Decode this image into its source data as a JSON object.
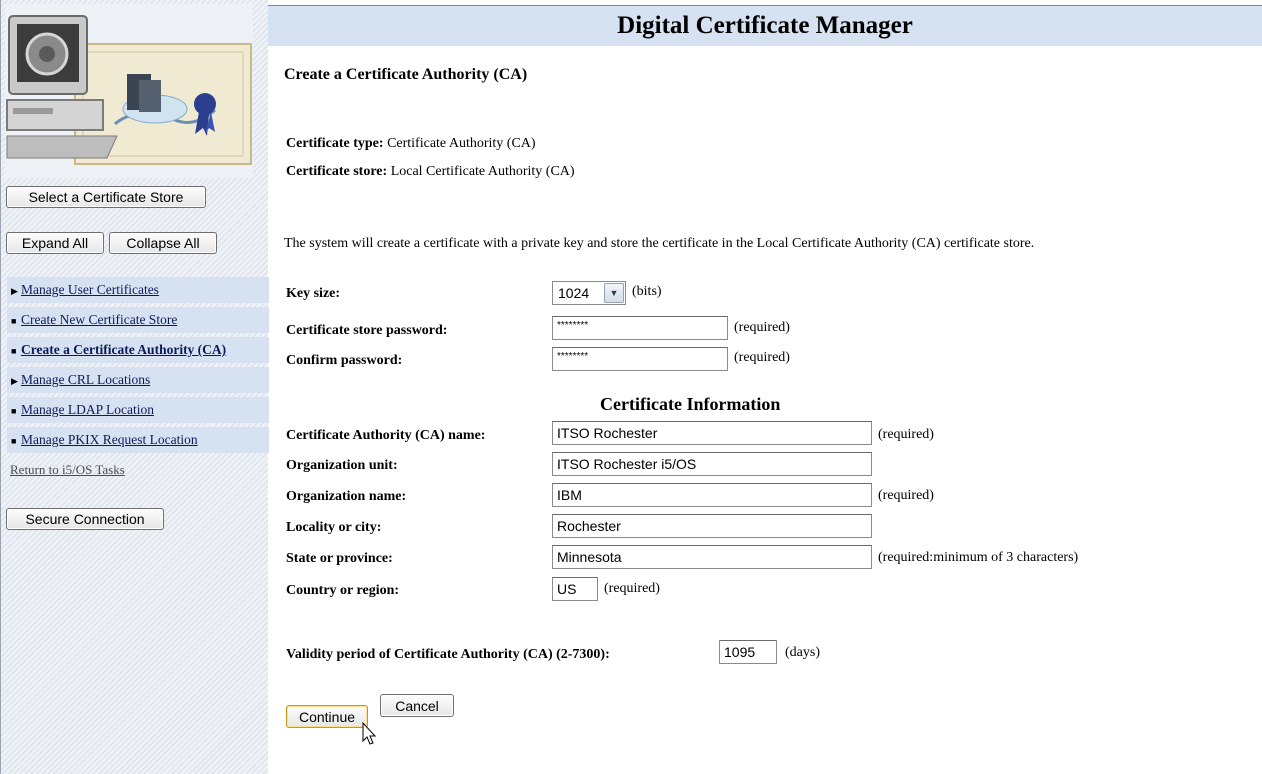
{
  "header": {
    "title": "Digital Certificate Manager"
  },
  "sidebar": {
    "select_store_label": "Select a Certificate Store",
    "expand_all_label": "Expand All",
    "collapse_all_label": "Collapse All",
    "nav_items": [
      {
        "label": "Manage User Certificates",
        "marker": "▶"
      },
      {
        "label": "Create New Certificate Store",
        "marker": "■"
      },
      {
        "label": "Create a Certificate Authority (CA)",
        "marker": "■"
      },
      {
        "label": "Manage CRL Locations",
        "marker": "▶"
      },
      {
        "label": "Manage LDAP Location",
        "marker": "■"
      },
      {
        "label": "Manage PKIX Request Location",
        "marker": "■"
      }
    ],
    "return_link": "Return to i5/OS Tasks",
    "secure_connection_label": "Secure Connection"
  },
  "main": {
    "page_title": "Create a Certificate Authority (CA)",
    "cert_type_label": "Certificate type:",
    "cert_type_value": "Certificate Authority (CA)",
    "cert_store_label": "Certificate store:",
    "cert_store_value": "Local Certificate Authority (CA)",
    "description": "The system will create a certificate with a private key and store the certificate in the Local Certificate Authority (CA) certificate store.",
    "key_size": {
      "label": "Key size:",
      "value": "1024",
      "unit": "(bits)"
    },
    "store_password": {
      "label": "Certificate store password:",
      "value": "********",
      "note": "(required)"
    },
    "confirm_password": {
      "label": "Confirm password:",
      "value": "********",
      "note": "(required)"
    },
    "section_title": "Certificate Information",
    "ca_name": {
      "label": "Certificate Authority (CA) name:",
      "value": "ITSO Rochester",
      "note": "(required)"
    },
    "org_unit": {
      "label": "Organization unit:",
      "value": "ITSO Rochester i5/OS"
    },
    "org_name": {
      "label": "Organization name:",
      "value": "IBM",
      "note": "(required)"
    },
    "locality": {
      "label": "Locality or city:",
      "value": "Rochester"
    },
    "state": {
      "label": "State or province:",
      "value": "Minnesota",
      "note": "(required:minimum of 3 characters)"
    },
    "country": {
      "label": "Country or region:",
      "value": "US",
      "note": "(required)"
    },
    "validity": {
      "label": "Validity period of Certificate Authority (CA) (2-7300):",
      "value": "1095",
      "unit": "(days)"
    },
    "continue_label": "Continue",
    "cancel_label": "Cancel"
  }
}
